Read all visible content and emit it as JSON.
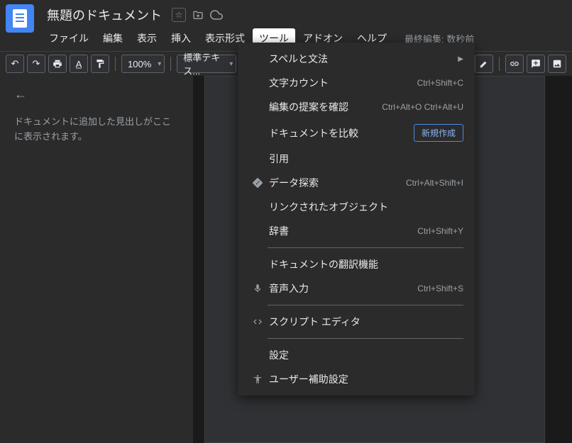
{
  "doc": {
    "title": "無題のドキュメント",
    "last_edit": "最終編集: 数秒前"
  },
  "menu": {
    "items": [
      "ファイル",
      "編集",
      "表示",
      "挿入",
      "表示形式",
      "ツール",
      "アドオン",
      "ヘルプ"
    ],
    "active_index": 5
  },
  "toolbar": {
    "zoom": "100%",
    "style": "標準テキス..."
  },
  "outline": {
    "message": "ドキュメントに追加した見出しがここに表示されます。"
  },
  "dropdown": {
    "spell": "スペルと文法",
    "wordcount": {
      "label": "文字カウント",
      "shortcut": "Ctrl+Shift+C"
    },
    "review": {
      "label": "編集の提案を確認",
      "shortcut": "Ctrl+Alt+O Ctrl+Alt+U"
    },
    "compare": {
      "label": "ドキュメントを比較",
      "button": "新規作成"
    },
    "citation": "引用",
    "explore": {
      "label": "データ探索",
      "shortcut": "Ctrl+Alt+Shift+I"
    },
    "linked": "リンクされたオブジェクト",
    "dictionary": {
      "label": "辞書",
      "shortcut": "Ctrl+Shift+Y"
    },
    "translate": "ドキュメントの翻訳機能",
    "voice": {
      "label": "音声入力",
      "shortcut": "Ctrl+Shift+S"
    },
    "script": "スクリプト エディタ",
    "settings": "設定",
    "accessibility": "ユーザー補助設定"
  }
}
